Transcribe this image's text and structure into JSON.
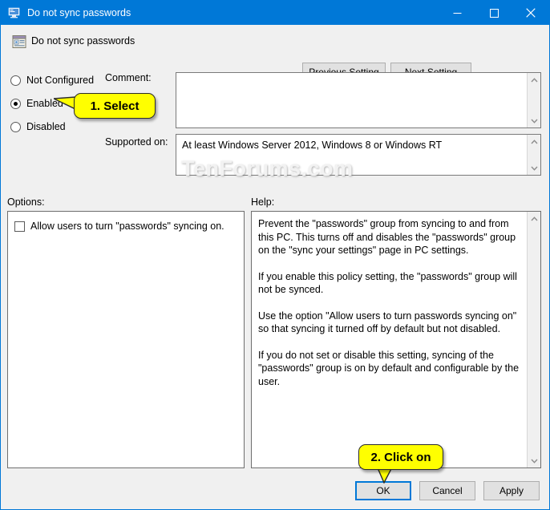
{
  "window": {
    "title": "Do not sync passwords",
    "icon": "monitor-policy-icon",
    "border_color": "#0078d7",
    "titlebar_color": "#0078d7",
    "controls": {
      "minimize": "minimize-icon",
      "maximize": "maximize-icon",
      "close": "close-icon"
    }
  },
  "header": {
    "title": "Do not sync passwords",
    "icon": "policy-setting-icon",
    "previous_label": "Previous Setting",
    "next_label": "Next Setting"
  },
  "state_options": {
    "selected": "Enabled",
    "items": [
      {
        "label": "Not Configured",
        "checked": false
      },
      {
        "label": "Enabled",
        "checked": true
      },
      {
        "label": "Disabled",
        "checked": false
      }
    ]
  },
  "comment": {
    "label": "Comment:",
    "value": "",
    "placeholder": ""
  },
  "supported_on": {
    "label": "Supported on:",
    "value": "At least Windows Server 2012, Windows 8 or Windows RT"
  },
  "options": {
    "label": "Options:",
    "checkboxes": [
      {
        "label": "Allow users to turn \"passwords\" syncing on.",
        "checked": false
      }
    ]
  },
  "help": {
    "label": "Help:",
    "paragraphs": [
      "Prevent the \"passwords\" group from syncing to and from this PC.  This turns off and disables the \"passwords\" group on the \"sync your settings\" page in PC settings.",
      "If you enable this policy setting, the \"passwords\" group will not be synced.",
      "Use the option \"Allow users to turn passwords syncing on\" so that syncing it turned off by default but not disabled.",
      "If you do not set or disable this setting, syncing of the \"passwords\" group is on by default and configurable by the user."
    ]
  },
  "footer": {
    "ok_label": "OK",
    "cancel_label": "Cancel",
    "apply_label": "Apply",
    "focused_button": "OK",
    "focus_color": "#0078d7"
  },
  "annotations": [
    {
      "text": "1. Select",
      "target": "Enabled radio button",
      "tail": "left"
    },
    {
      "text": "2. Click on",
      "target": "OK button",
      "tail": "down"
    }
  ],
  "watermark": {
    "text": "TenForums.com"
  }
}
